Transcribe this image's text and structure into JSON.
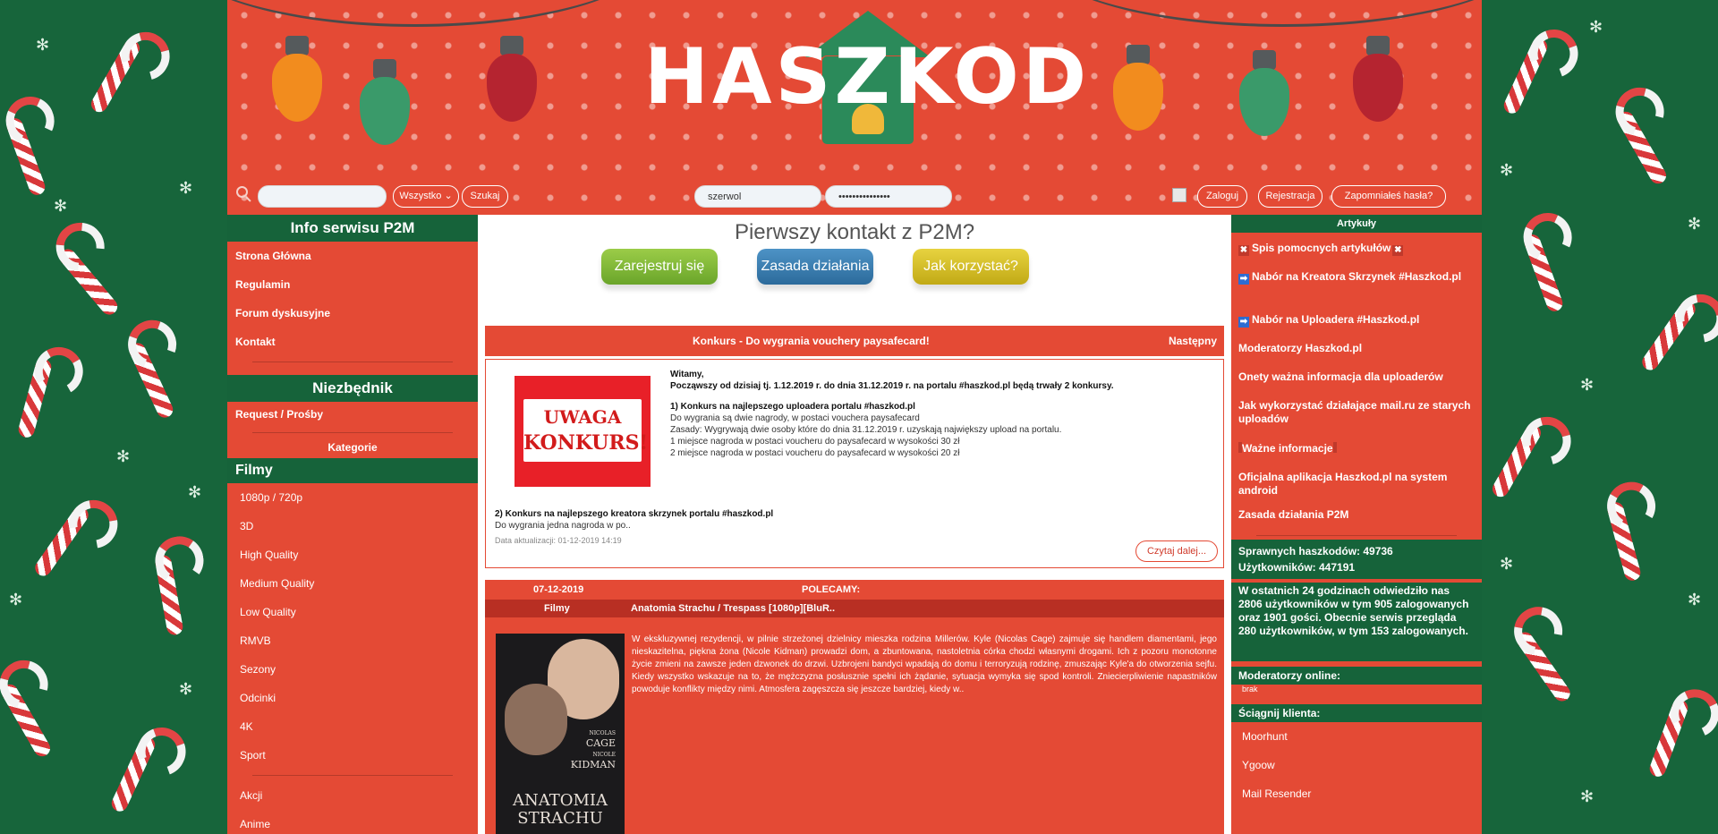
{
  "colors": {
    "green": "#16633a",
    "red": "#e44a35",
    "white": "#ffffff"
  },
  "header": {
    "logo": "HASZKOD"
  },
  "toolbar": {
    "search_value": "",
    "category_select": "Wszystko",
    "search_button": "Szukaj",
    "username_value": "szerwol",
    "password_value": "•••••••••••••••",
    "login_button": "Zaloguj",
    "register_button": "Rejestracja",
    "forgot_button": "Zapomniałeś hasła?"
  },
  "left": {
    "info_title": "Info serwisu P2M",
    "info_links": [
      "Strona Główna",
      "Regulamin",
      "Forum dyskusyjne",
      "Kontakt"
    ],
    "niezbednik_title": "Niezbędnik",
    "niezbednik_links": [
      "Request / Prośby"
    ],
    "kategorie_title": "Kategorie",
    "filmy_title": "Filmy",
    "categories": [
      "1080p / 720p",
      "3D",
      "High Quality",
      "Medium Quality",
      "Low Quality",
      "RMVB",
      "Sezony",
      "Odcinki",
      "4K",
      "Sport"
    ],
    "categories2": [
      "Akcji",
      "Anime"
    ]
  },
  "center": {
    "first_contact": "Pierwszy kontakt z P2M?",
    "buttons": [
      "Zarejestruj się",
      "Zasada działania",
      "Jak korzystać?"
    ],
    "news_bar_title": "Konkurs - Do wygrania vouchery paysafecard!",
    "news_bar_next": "Następny",
    "konkurs_img_line1": "UWAGA",
    "konkurs_img_line2": "KONKURS!",
    "news": {
      "greeting": "Witamy,",
      "intro": "Począwszy od dzisiaj tj. 1.12.2019 r. do dnia 31.12.2019 r. na portalu #haszkod.pl będą trwały 2 konkursy.",
      "k1_title": "1) Konkurs na najlepszego uploadera portalu #haszkod.pl",
      "k1_l1": "Do wygrania są dwie nagrody, w postaci vouchera paysafecard",
      "k1_l2": "Zasady: Wygrywają dwie osoby które do dnia 31.12.2019 r. uzyskają największy upload na portalu.",
      "k1_l3": "1 miejsce nagroda w postaci voucheru do paysafecard w wysokości 30 zł",
      "k1_l4": "2 miejsce nagroda w postaci voucheru do paysafecard w wysokości 20 zł",
      "k2_title": "2) Konkurs na najlepszego kreatora skrzynek portalu #haszkod.pl",
      "k2_l1": "Do wygrania jedna nagroda w po..",
      "updated": "Data aktualizacji: 01-12-2019 14:19",
      "read_more": "Czytaj dalej..."
    },
    "movie": {
      "date": "07-12-2019",
      "polecamy": "POLECAMY:",
      "category": "Filmy",
      "title": "Anatomia Strachu / Trespass [1080p][BluR..",
      "poster_name1": "NICOLAS",
      "poster_name2": "CAGE",
      "poster_name3": "NICOLE",
      "poster_name4": "KIDMAN",
      "poster_title1": "ANATOMIA",
      "poster_title2": "STRACHU",
      "description": "W ekskluzywnej rezydencji, w pilnie strzeżonej dzielnicy mieszka rodzina Millerów. Kyle (Nicolas Cage) zajmuje się handlem diamentami, jego nieskazitelna, piękna żona (Nicole Kidman) prowadzi dom, a zbuntowana, nastoletnia córka chodzi własnymi drogami. Ich z pozoru monotonne życie zmieni na zawsze jeden dzwonek do drzwi. Uzbrojeni bandyci wpadają do domu i terroryzują rodzinę, zmuszając Kyle'a do otworzenia sejfu. Kiedy wszystko wskazuje na to, że mężczyzna posłusznie spełni ich żądanie, sytuacja wymyka się spod kontroli. Zniecierpliwienie napastników powoduje konflikty między nimi. Atmosfera zagęszcza się jeszcze bardziej, kiedy w.."
    }
  },
  "right": {
    "articles_title": "Artykuły",
    "articles": [
      "Spis pomocnych artykułów",
      "Nabór na Kreatora Skrzynek #Haszkod.pl",
      "Nabór na Uploadera #Haszkod.pl",
      "Moderatorzy Haszkod.pl",
      "Onety ważna informacja dla uploaderów",
      "Jak wykorzystać działające mail.ru ze starych uploadów",
      "Ważne informacje",
      "Oficjalna aplikacja Haszkod.pl na system android",
      "Zasada działania P2M"
    ],
    "stat_haszkody": "Sprawnych haszkodów: 49736",
    "stat_users": "Użytkowników: 447191",
    "visits": "W ostatnich 24 godzinach odwiedziło nas 2806 użytkowników w tym 905 zalogowanych oraz 1901 gości. Obecnie serwis przegląda 280 użytkowników, w tym 153 zalogowanych.",
    "mods_online_title": "Moderatorzy online:",
    "mods_online_value": "brak",
    "client_title": "Ściągnij klienta:",
    "clients": [
      "Moorhunt",
      "Ygoow",
      "Mail Resender"
    ]
  }
}
